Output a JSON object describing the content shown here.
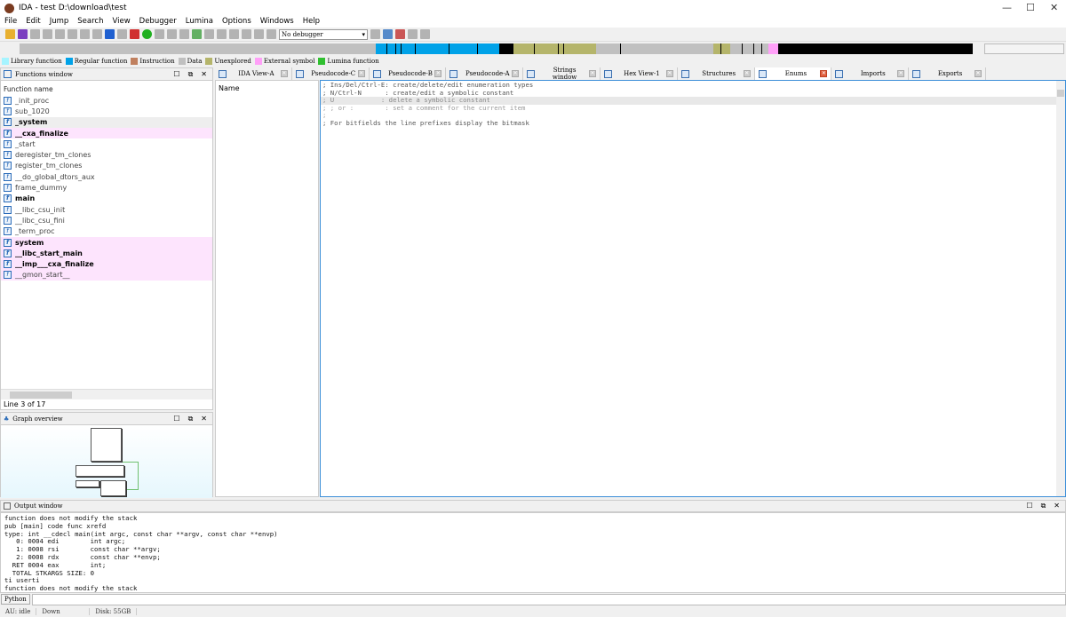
{
  "window": {
    "title": "IDA - test D:\\download\\test"
  },
  "menu": [
    "File",
    "Edit",
    "Jump",
    "Search",
    "View",
    "Debugger",
    "Lumina",
    "Options",
    "Windows",
    "Help"
  ],
  "toolbar": {
    "debugger_select": "No debugger"
  },
  "navigation": {
    "segments": [
      {
        "start": 0,
        "end": 37.4,
        "color": "#c0c0c0"
      },
      {
        "start": 37.4,
        "end": 50.3,
        "color": "#00a2e8"
      },
      {
        "start": 50.3,
        "end": 51.8,
        "color": "#000000"
      },
      {
        "start": 51.8,
        "end": 60.5,
        "color": "#b5b56b"
      },
      {
        "start": 60.5,
        "end": 72.8,
        "color": "#c0c0c0"
      },
      {
        "start": 72.8,
        "end": 74.6,
        "color": "#b5b56b"
      },
      {
        "start": 74.6,
        "end": 78.6,
        "color": "#c0c0c0"
      },
      {
        "start": 78.6,
        "end": 79.6,
        "color": "#ffa0f8"
      },
      {
        "start": 79.6,
        "end": 100,
        "color": "#000000"
      }
    ]
  },
  "legend": [
    {
      "label": "Library function",
      "color": "#a6f4ff"
    },
    {
      "label": "Regular function",
      "color": "#00a2e8"
    },
    {
      "label": "Instruction",
      "color": "#c0805f"
    },
    {
      "label": "Data",
      "color": "#c0c0c0"
    },
    {
      "label": "Unexplored",
      "color": "#b5b56b"
    },
    {
      "label": "External symbol",
      "color": "#ffa0f8"
    },
    {
      "label": "Lumina function",
      "color": "#30c030"
    }
  ],
  "functions_window": {
    "title": "Functions window",
    "column": "Function name",
    "status": "Line 3 of 17",
    "items": [
      {
        "name": "_init_proc",
        "style": ""
      },
      {
        "name": "sub_1020",
        "style": ""
      },
      {
        "name": "_system",
        "style": "b sel"
      },
      {
        "name": "__cxa_finalize",
        "style": "b pink"
      },
      {
        "name": "_start",
        "style": ""
      },
      {
        "name": "deregister_tm_clones",
        "style": ""
      },
      {
        "name": "register_tm_clones",
        "style": ""
      },
      {
        "name": "__do_global_dtors_aux",
        "style": ""
      },
      {
        "name": "frame_dummy",
        "style": ""
      },
      {
        "name": "main",
        "style": "b"
      },
      {
        "name": "__libc_csu_init",
        "style": ""
      },
      {
        "name": "__libc_csu_fini",
        "style": ""
      },
      {
        "name": "_term_proc",
        "style": ""
      },
      {
        "name": "system",
        "style": "b pink"
      },
      {
        "name": "__libc_start_main",
        "style": "b pink"
      },
      {
        "name": "__imp___cxa_finalize",
        "style": "b pink"
      },
      {
        "name": "__gmon_start__",
        "style": "pink"
      }
    ]
  },
  "graph_overview": {
    "title": "Graph overview"
  },
  "tabs": [
    {
      "label": "IDA View-A"
    },
    {
      "label": "Pseudocode-C"
    },
    {
      "label": "Pseudocode-B"
    },
    {
      "label": "Pseudocode-A"
    },
    {
      "label": "Strings window"
    },
    {
      "label": "Hex View-1"
    },
    {
      "label": "Structures"
    },
    {
      "label": "Enums",
      "active": true
    },
    {
      "label": "Imports"
    },
    {
      "label": "Exports"
    }
  ],
  "enums": {
    "column": "Name",
    "lines": [
      {
        "text": "; Ins/Del/Ctrl-E: create/delete/edit enumeration types",
        "cls": ""
      },
      {
        "text": "; N/Ctrl-N      : create/edit a symbolic constant",
        "cls": ""
      },
      {
        "text": "; U            : delete a symbolic constant",
        "cls": "hl"
      },
      {
        "text": "; ; or :        : set a comment for the current item",
        "cls": "dim"
      },
      {
        "text": ";",
        "cls": "dim"
      },
      {
        "text": "; For bitfields the line prefixes display the bitmask",
        "cls": ""
      }
    ]
  },
  "output_window": {
    "title": "Output window",
    "lines": [
      "function does not modify the stack",
      "pub [main] code func xrefd",
      "type: int __cdecl main(int argc, const char **argv, const char **envp)",
      "   0: 0004 edi        int argc;",
      "   1: 0008 rsi        const char **argv;",
      "   2: 0008 rdx        const char **envp;",
      "  RET 0004 eax        int;",
      "  TOTAL STKARGS SIZE: 0",
      "ti userti",
      "function does not modify the stack"
    ]
  },
  "python_button": "Python",
  "status": {
    "au": "AU:  idle",
    "direction": "Down",
    "disk": "Disk: 55GB"
  }
}
